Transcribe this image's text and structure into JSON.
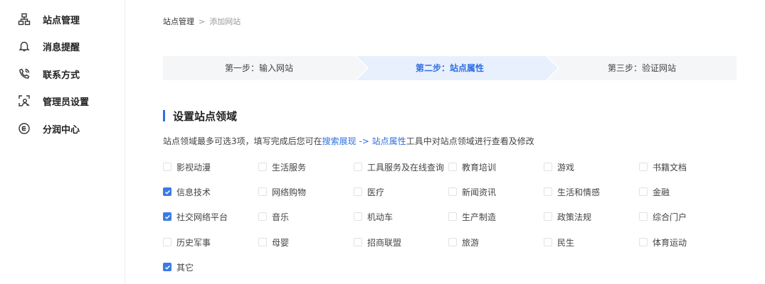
{
  "sidebar": {
    "items": [
      {
        "label": "站点管理",
        "icon": "sitemap-icon"
      },
      {
        "label": "消息提醒",
        "icon": "bell-icon"
      },
      {
        "label": "联系方式",
        "icon": "phone-icon"
      },
      {
        "label": "管理员设置",
        "icon": "admin-icon"
      },
      {
        "label": "分润中心",
        "icon": "share-icon"
      }
    ]
  },
  "breadcrumb": {
    "root": "站点管理",
    "separator": ">",
    "current": "添加网站"
  },
  "steps": [
    {
      "label": "第一步：输入网站",
      "active": false
    },
    {
      "label": "第二步：站点属性",
      "active": true
    },
    {
      "label": "第三步：验证网站",
      "active": false
    }
  ],
  "section": {
    "title": "设置站点领域",
    "desc_prefix": "站点领域最多可选3项，填写完成后您可在",
    "desc_link1": "搜索展现",
    "desc_arrow": " -> ",
    "desc_link2": "站点属性",
    "desc_suffix": "工具中对站点领域进行查看及修改"
  },
  "options": [
    {
      "label": "影视动漫",
      "checked": false
    },
    {
      "label": "生活服务",
      "checked": false
    },
    {
      "label": "工具服务及在线查询",
      "checked": false
    },
    {
      "label": "教育培训",
      "checked": false
    },
    {
      "label": "游戏",
      "checked": false
    },
    {
      "label": "书籍文档",
      "checked": false
    },
    {
      "label": "信息技术",
      "checked": true
    },
    {
      "label": "网络购物",
      "checked": false
    },
    {
      "label": "医疗",
      "checked": false
    },
    {
      "label": "新闻资讯",
      "checked": false
    },
    {
      "label": "生活和情感",
      "checked": false
    },
    {
      "label": "金融",
      "checked": false
    },
    {
      "label": "社交网络平台",
      "checked": true
    },
    {
      "label": "音乐",
      "checked": false
    },
    {
      "label": "机动车",
      "checked": false
    },
    {
      "label": "生产制造",
      "checked": false
    },
    {
      "label": "政策法规",
      "checked": false
    },
    {
      "label": "综合门户",
      "checked": false
    },
    {
      "label": "历史军事",
      "checked": false
    },
    {
      "label": "母婴",
      "checked": false
    },
    {
      "label": "招商联盟",
      "checked": false
    },
    {
      "label": "旅游",
      "checked": false
    },
    {
      "label": "民生",
      "checked": false
    },
    {
      "label": "体育运动",
      "checked": false
    },
    {
      "label": "其它",
      "checked": true
    }
  ],
  "colors": {
    "accent": "#2f6fe0",
    "step_bg": "#f5f6f8",
    "step_active_bg": "#e8f0fe",
    "checkbox_checked": "#3a7be6"
  }
}
